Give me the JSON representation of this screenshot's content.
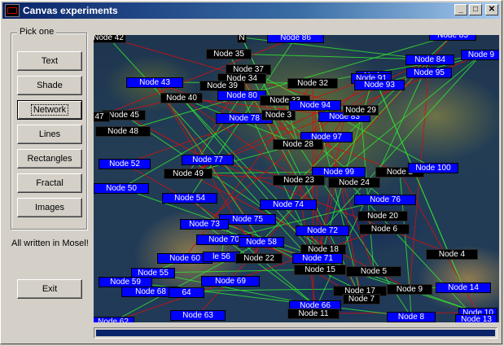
{
  "window": {
    "title": "Canvas experiments",
    "minimize": "_",
    "maximize": "□",
    "close": "✕"
  },
  "panel": {
    "group_label": "Pick one",
    "buttons": [
      "Text",
      "Shade",
      "Network",
      "Lines",
      "Rectangles",
      "Fractal",
      "Images"
    ],
    "active": "Network",
    "note": "All written in Mosel!",
    "exit_label": "Exit"
  },
  "progress": {
    "fraction": 1.0,
    "color": "#0a246a"
  },
  "colors": {
    "node_blue": "#0000ff",
    "node_black": "#000000",
    "edge_red": "#d01010",
    "edge_green": "#30e030"
  },
  "nodes": [
    {
      "label": "Node 42",
      "style": "black"
    },
    {
      "label": "N",
      "style": "black"
    },
    {
      "label": "Node 86",
      "style": "blue"
    },
    {
      "label": "Node 85",
      "style": "blue"
    },
    {
      "label": "Node 35",
      "style": "black"
    },
    {
      "label": "Node 84",
      "style": "blue"
    },
    {
      "label": "Node 9",
      "style": "blue"
    },
    {
      "label": "Node 37",
      "style": "black"
    },
    {
      "label": "Node 34",
      "style": "black"
    },
    {
      "label": "Node 43",
      "style": "blue"
    },
    {
      "label": "Node 39",
      "style": "black"
    },
    {
      "label": "Node 32",
      "style": "black"
    },
    {
      "label": "Node",
      "style": "blue"
    },
    {
      "label": "Node 91",
      "style": "blue"
    },
    {
      "label": "Node 95",
      "style": "blue"
    },
    {
      "label": "Node 93",
      "style": "blue"
    },
    {
      "label": "Node 40",
      "style": "black"
    },
    {
      "label": "Node 80",
      "style": "blue"
    },
    {
      "label": "Node 33",
      "style": "black"
    },
    {
      "label": "Node 94",
      "style": "blue"
    },
    {
      "label": "Node 45",
      "style": "black"
    },
    {
      "label": "47",
      "style": "black"
    },
    {
      "label": "Node 78",
      "style": "blue"
    },
    {
      "label": "Node 3",
      "style": "black"
    },
    {
      "label": "Node 83",
      "style": "blue"
    },
    {
      "label": "Node 29",
      "style": "black"
    },
    {
      "label": "Node 48",
      "style": "black"
    },
    {
      "label": "Node 97",
      "style": "blue"
    },
    {
      "label": "Node 28",
      "style": "black"
    },
    {
      "label": "Node 77",
      "style": "blue"
    },
    {
      "label": "Node 52",
      "style": "blue"
    },
    {
      "label": "Node 49",
      "style": "black"
    },
    {
      "label": "Node 99",
      "style": "blue"
    },
    {
      "label": "Node 2",
      "style": "black"
    },
    {
      "label": "Node 100",
      "style": "blue"
    },
    {
      "label": "Node 23",
      "style": "black"
    },
    {
      "label": "Node 24",
      "style": "black"
    },
    {
      "label": "Node 50",
      "style": "blue"
    },
    {
      "label": "Node 54",
      "style": "blue"
    },
    {
      "label": "Node 76",
      "style": "blue"
    },
    {
      "label": "Node 74",
      "style": "blue"
    },
    {
      "label": "Node 20",
      "style": "black"
    },
    {
      "label": "Node 75",
      "style": "blue"
    },
    {
      "label": "Node 73",
      "style": "blue"
    },
    {
      "label": "Node 72",
      "style": "blue"
    },
    {
      "label": "Node 6",
      "style": "black"
    },
    {
      "label": "Node 70",
      "style": "blue"
    },
    {
      "label": "Node 58",
      "style": "blue"
    },
    {
      "label": "Node 18",
      "style": "black"
    },
    {
      "label": "Node 4",
      "style": "black"
    },
    {
      "label": "Node 60",
      "style": "blue"
    },
    {
      "label": "le 56",
      "style": "blue"
    },
    {
      "label": "Node 22",
      "style": "black"
    },
    {
      "label": "Node 71",
      "style": "blue"
    },
    {
      "label": "Node 15",
      "style": "black"
    },
    {
      "label": "Node 5",
      "style": "black"
    },
    {
      "label": "Node 55",
      "style": "blue"
    },
    {
      "label": "Node 59",
      "style": "blue"
    },
    {
      "label": "Node 69",
      "style": "blue"
    },
    {
      "label": "Node 14",
      "style": "blue"
    },
    {
      "label": "Node 68",
      "style": "blue"
    },
    {
      "label": "64",
      "style": "blue"
    },
    {
      "label": "Node 17",
      "style": "black"
    },
    {
      "label": "Node 9",
      "style": "black"
    },
    {
      "label": "Node 7",
      "style": "black"
    },
    {
      "label": "Node 66",
      "style": "blue"
    },
    {
      "label": "Node 11",
      "style": "black"
    },
    {
      "label": "Node 63",
      "style": "blue"
    },
    {
      "label": "Node 8",
      "style": "blue"
    },
    {
      "label": "Node 10",
      "style": "blue"
    },
    {
      "label": "Node 13",
      "style": "blue"
    },
    {
      "label": "Node 62",
      "style": "blue"
    }
  ]
}
